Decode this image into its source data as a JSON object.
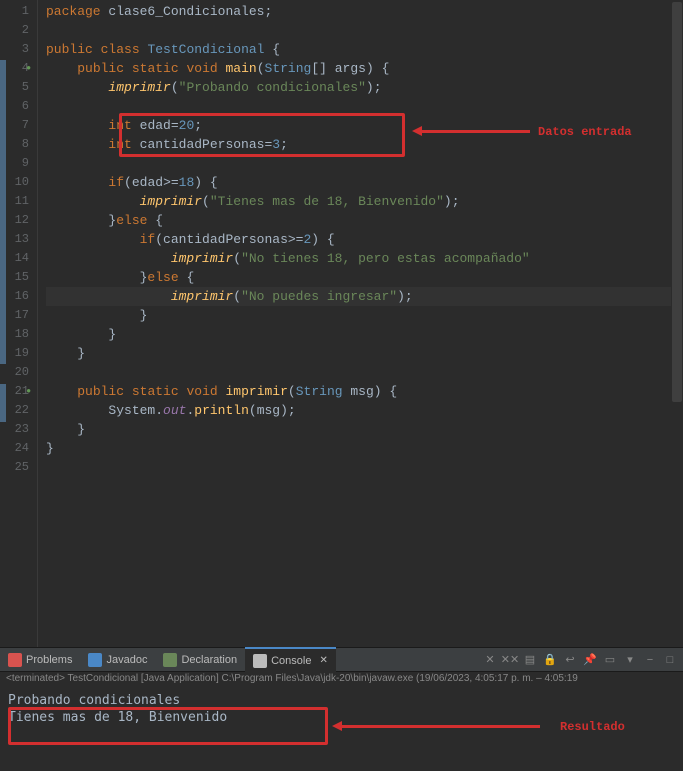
{
  "annotations": {
    "input_label": "Datos entrada",
    "output_label": "Resultado"
  },
  "code": {
    "lines": [
      {
        "n": "1",
        "tokens": [
          {
            "t": "kw",
            "v": "package"
          },
          {
            "t": "p",
            "v": " "
          },
          {
            "t": "classname",
            "v": "clase6_Condicionales"
          },
          {
            "t": "p",
            "v": ";"
          }
        ]
      },
      {
        "n": "2",
        "tokens": []
      },
      {
        "n": "3",
        "tokens": [
          {
            "t": "kw",
            "v": "public"
          },
          {
            "t": "p",
            "v": " "
          },
          {
            "t": "kw",
            "v": "class"
          },
          {
            "t": "p",
            "v": " "
          },
          {
            "t": "type",
            "v": "TestCondicional"
          },
          {
            "t": "p",
            "v": " {"
          }
        ]
      },
      {
        "n": "4",
        "mark": "run",
        "tokens": [
          {
            "t": "p",
            "v": "    "
          },
          {
            "t": "kw",
            "v": "public"
          },
          {
            "t": "p",
            "v": " "
          },
          {
            "t": "kw",
            "v": "static"
          },
          {
            "t": "p",
            "v": " "
          },
          {
            "t": "kw",
            "v": "void"
          },
          {
            "t": "p",
            "v": " "
          },
          {
            "t": "method",
            "v": "main"
          },
          {
            "t": "p",
            "v": "("
          },
          {
            "t": "type",
            "v": "String"
          },
          {
            "t": "p",
            "v": "[] "
          },
          {
            "t": "param",
            "v": "args"
          },
          {
            "t": "p",
            "v": ") {"
          }
        ]
      },
      {
        "n": "5",
        "tokens": [
          {
            "t": "p",
            "v": "        "
          },
          {
            "t": "methodcall",
            "v": "imprimir"
          },
          {
            "t": "p",
            "v": "("
          },
          {
            "t": "str",
            "v": "\"Probando condicionales\""
          },
          {
            "t": "p",
            "v": ");"
          }
        ]
      },
      {
        "n": "6",
        "tokens": []
      },
      {
        "n": "7",
        "tokens": [
          {
            "t": "p",
            "v": "        "
          },
          {
            "t": "kw",
            "v": "int"
          },
          {
            "t": "p",
            "v": " "
          },
          {
            "t": "var",
            "v": "edad"
          },
          {
            "t": "p",
            "v": "="
          },
          {
            "t": "num",
            "v": "20"
          },
          {
            "t": "p",
            "v": ";"
          }
        ]
      },
      {
        "n": "8",
        "tokens": [
          {
            "t": "p",
            "v": "        "
          },
          {
            "t": "kw",
            "v": "int"
          },
          {
            "t": "p",
            "v": " "
          },
          {
            "t": "var",
            "v": "cantidadPersonas"
          },
          {
            "t": "p",
            "v": "="
          },
          {
            "t": "num",
            "v": "3"
          },
          {
            "t": "p",
            "v": ";"
          }
        ]
      },
      {
        "n": "9",
        "tokens": []
      },
      {
        "n": "10",
        "tokens": [
          {
            "t": "p",
            "v": "        "
          },
          {
            "t": "kw",
            "v": "if"
          },
          {
            "t": "p",
            "v": "("
          },
          {
            "t": "var",
            "v": "edad"
          },
          {
            "t": "p",
            "v": ">="
          },
          {
            "t": "num",
            "v": "18"
          },
          {
            "t": "p",
            "v": ") {"
          }
        ]
      },
      {
        "n": "11",
        "tokens": [
          {
            "t": "p",
            "v": "            "
          },
          {
            "t": "methodcall",
            "v": "imprimir"
          },
          {
            "t": "p",
            "v": "("
          },
          {
            "t": "str",
            "v": "\"Tienes mas de 18, Bienvenido\""
          },
          {
            "t": "p",
            "v": ");"
          }
        ]
      },
      {
        "n": "12",
        "tokens": [
          {
            "t": "p",
            "v": "        }"
          },
          {
            "t": "kw",
            "v": "else"
          },
          {
            "t": "p",
            "v": " {"
          }
        ]
      },
      {
        "n": "13",
        "tokens": [
          {
            "t": "p",
            "v": "            "
          },
          {
            "t": "kw",
            "v": "if"
          },
          {
            "t": "p",
            "v": "("
          },
          {
            "t": "var",
            "v": "cantidadPersonas"
          },
          {
            "t": "p",
            "v": ">="
          },
          {
            "t": "num",
            "v": "2"
          },
          {
            "t": "p",
            "v": ") {"
          }
        ]
      },
      {
        "n": "14",
        "tokens": [
          {
            "t": "p",
            "v": "                "
          },
          {
            "t": "methodcall",
            "v": "imprimir"
          },
          {
            "t": "p",
            "v": "("
          },
          {
            "t": "str",
            "v": "\"No tienes 18, pero estas acompañado\""
          }
        ]
      },
      {
        "n": "15",
        "tokens": [
          {
            "t": "p",
            "v": "            }"
          },
          {
            "t": "kw",
            "v": "else"
          },
          {
            "t": "p",
            "v": " {"
          }
        ]
      },
      {
        "n": "16",
        "hl": true,
        "tokens": [
          {
            "t": "p",
            "v": "                "
          },
          {
            "t": "methodcall",
            "v": "imprimir"
          },
          {
            "t": "p",
            "v": "("
          },
          {
            "t": "str",
            "v": "\"No puedes ingresar\""
          },
          {
            "t": "p",
            "v": ");"
          }
        ]
      },
      {
        "n": "17",
        "tokens": [
          {
            "t": "p",
            "v": "            }"
          }
        ]
      },
      {
        "n": "18",
        "tokens": [
          {
            "t": "p",
            "v": "        }"
          }
        ]
      },
      {
        "n": "19",
        "tokens": [
          {
            "t": "p",
            "v": "    }"
          }
        ]
      },
      {
        "n": "20",
        "tokens": []
      },
      {
        "n": "21",
        "mark": "run",
        "tokens": [
          {
            "t": "p",
            "v": "    "
          },
          {
            "t": "kw",
            "v": "public"
          },
          {
            "t": "p",
            "v": " "
          },
          {
            "t": "kw",
            "v": "static"
          },
          {
            "t": "p",
            "v": " "
          },
          {
            "t": "kw",
            "v": "void"
          },
          {
            "t": "p",
            "v": " "
          },
          {
            "t": "method",
            "v": "imprimir"
          },
          {
            "t": "p",
            "v": "("
          },
          {
            "t": "type",
            "v": "String"
          },
          {
            "t": "p",
            "v": " "
          },
          {
            "t": "param",
            "v": "msg"
          },
          {
            "t": "p",
            "v": ") {"
          }
        ]
      },
      {
        "n": "22",
        "tokens": [
          {
            "t": "p",
            "v": "        "
          },
          {
            "t": "classname",
            "v": "System"
          },
          {
            "t": "p",
            "v": "."
          },
          {
            "t": "static",
            "v": "out"
          },
          {
            "t": "p",
            "v": "."
          },
          {
            "t": "method",
            "v": "println"
          },
          {
            "t": "p",
            "v": "("
          },
          {
            "t": "param",
            "v": "msg"
          },
          {
            "t": "p",
            "v": ");"
          }
        ]
      },
      {
        "n": "23",
        "tokens": [
          {
            "t": "p",
            "v": "    }"
          }
        ]
      },
      {
        "n": "24",
        "tokens": [
          {
            "t": "p",
            "v": "}"
          }
        ]
      },
      {
        "n": "25",
        "tokens": []
      }
    ]
  },
  "tabs": {
    "items": [
      {
        "label": "Problems",
        "icon": "problems-icon"
      },
      {
        "label": "Javadoc",
        "icon": "javadoc-icon"
      },
      {
        "label": "Declaration",
        "icon": "declaration-icon"
      },
      {
        "label": "Console",
        "icon": "console-icon",
        "active": true,
        "closable": true
      }
    ]
  },
  "console": {
    "status": "<terminated> TestCondicional [Java Application] C:\\Program Files\\Java\\jdk-20\\bin\\javaw.exe (19/06/2023, 4:05:17 p. m. – 4:05:19",
    "output": [
      "Probando condicionales",
      "Tienes mas de 18, Bienvenido"
    ]
  }
}
